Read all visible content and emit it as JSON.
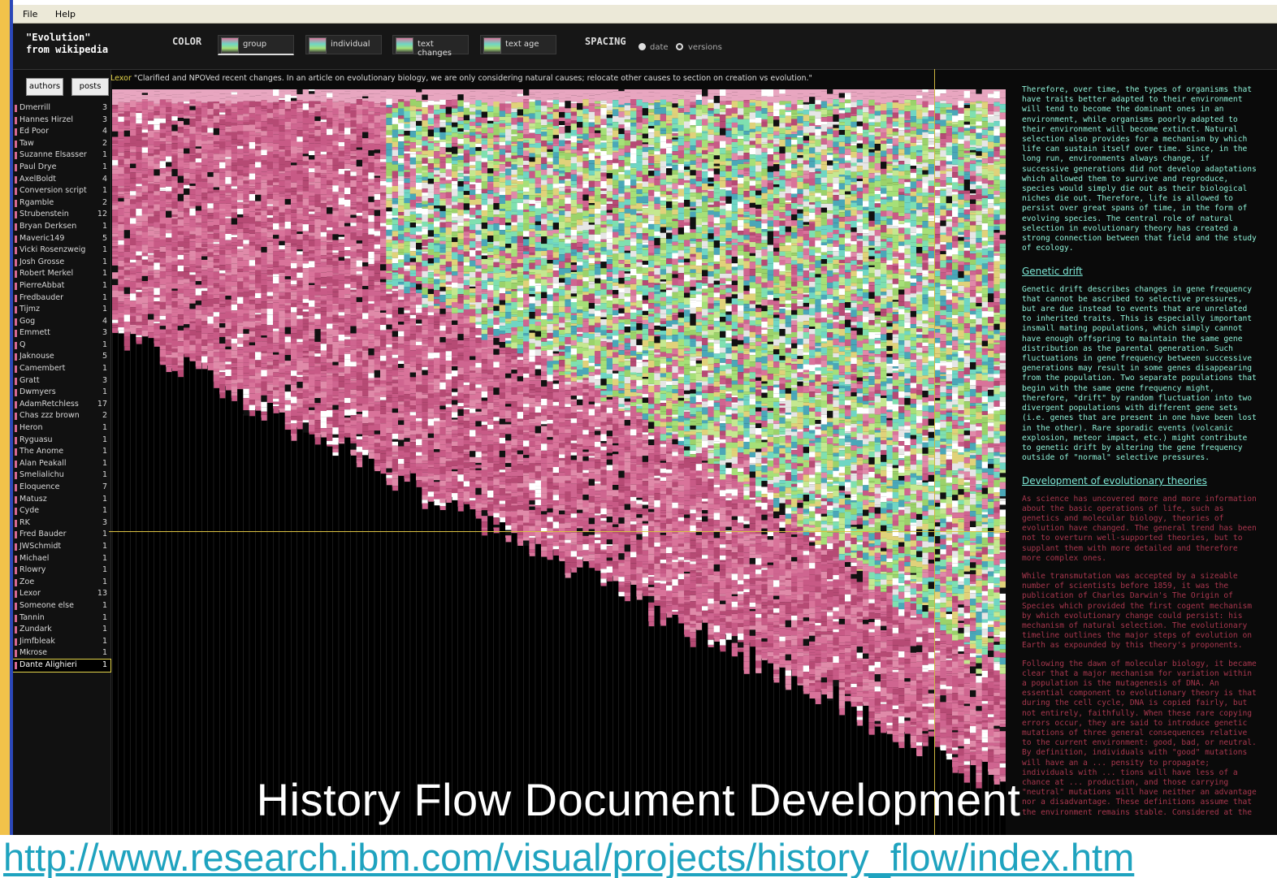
{
  "menu": {
    "items": [
      "File",
      "Help"
    ]
  },
  "header": {
    "doc_title": "\"Evolution\"\nfrom wikipedia",
    "color_label": "COLOR",
    "color_options": [
      "group",
      "individual",
      "text changes",
      "text age"
    ],
    "spacing_label": "SPACING",
    "spacing_options": [
      "date",
      "versions"
    ],
    "spacing_selected": "versions"
  },
  "sidebar": {
    "tabs": [
      "authors",
      "posts"
    ],
    "authors": [
      {
        "name": "Dmerrill",
        "count": "3"
      },
      {
        "name": "Hannes Hirzel",
        "count": "3"
      },
      {
        "name": "Ed Poor",
        "count": "4"
      },
      {
        "name": "Taw",
        "count": "2"
      },
      {
        "name": "Suzanne Elsasser",
        "count": "1"
      },
      {
        "name": "Paul Drye",
        "count": "1"
      },
      {
        "name": "AxelBoldt",
        "count": "4"
      },
      {
        "name": "Conversion script",
        "count": "1"
      },
      {
        "name": "Rgamble",
        "count": "2"
      },
      {
        "name": "Strubenstein",
        "count": "12"
      },
      {
        "name": "Bryan Derksen",
        "count": "1"
      },
      {
        "name": "Maveric149",
        "count": "5"
      },
      {
        "name": "Vicki Rosenzweig",
        "count": "1"
      },
      {
        "name": "Josh Grosse",
        "count": "1"
      },
      {
        "name": "Robert Merkel",
        "count": "1"
      },
      {
        "name": "PierreAbbat",
        "count": "1"
      },
      {
        "name": "Fredbauder",
        "count": "1"
      },
      {
        "name": "Tijmz",
        "count": "1"
      },
      {
        "name": "Gog",
        "count": "4"
      },
      {
        "name": "Emmett",
        "count": "3"
      },
      {
        "name": "Q",
        "count": "1"
      },
      {
        "name": "Jaknouse",
        "count": "5"
      },
      {
        "name": "Camembert",
        "count": "1"
      },
      {
        "name": "Gratt",
        "count": "3"
      },
      {
        "name": "Dwmyers",
        "count": "1"
      },
      {
        "name": "AdamRetchless",
        "count": "17"
      },
      {
        "name": "Chas zzz brown",
        "count": "2"
      },
      {
        "name": "Heron",
        "count": "1"
      },
      {
        "name": "Ryguasu",
        "count": "1"
      },
      {
        "name": "The Anome",
        "count": "1"
      },
      {
        "name": "Alan Peakall",
        "count": "1"
      },
      {
        "name": "Smelialichu",
        "count": "1"
      },
      {
        "name": "Eloquence",
        "count": "7"
      },
      {
        "name": "Matusz",
        "count": "1"
      },
      {
        "name": "Cyde",
        "count": "1"
      },
      {
        "name": "RK",
        "count": "3"
      },
      {
        "name": "Fred Bauder",
        "count": "1"
      },
      {
        "name": "JWSchmidt",
        "count": "1"
      },
      {
        "name": "Michael",
        "count": "1"
      },
      {
        "name": "Rlowry",
        "count": "1"
      },
      {
        "name": "Zoe",
        "count": "1"
      },
      {
        "name": "Lexor",
        "count": "13"
      },
      {
        "name": "Someone else",
        "count": "1"
      },
      {
        "name": "Tannin",
        "count": "1"
      },
      {
        "name": "Zundark",
        "count": "1"
      },
      {
        "name": "Jimfbleak",
        "count": "1"
      },
      {
        "name": "Mkrose",
        "count": "1"
      },
      {
        "name": "Dante Alighieri",
        "count": "1"
      }
    ],
    "selected_author": "Dante Alighieri"
  },
  "comment": {
    "author": "Lexor",
    "text": "\"Clarified and NPOVed recent changes.  In an article on evolutionary biology, we are only considering natural causes; relocate other causes to section on creation vs evolution.\""
  },
  "article": {
    "p1": "Therefore, over time, the types of organisms that have traits better adapted to their environment will tend to become the dominant ones in an environment, while organisms poorly adapted to their environment will become extinct. Natural selection also provides for a mechanism by which life can sustain itself over time. Since, in the long run, environments always change, if successive generations did not develop adaptations which allowed them to survive and reproduce, species would simply die out as their biological niches die out.  Therefore, life is allowed to persist over great spans of time, in the form of evolving species.  The central role of natural selection in evolutionary theory has created a strong connection between that field and the study of ecology.",
    "h1": "Genetic drift",
    "p2": "Genetic drift describes changes in gene frequency that cannot be ascribed to selective pressures, but are due instead to events that are unrelated to inherited traits. This is especially important insmall mating populations, which simply cannot have enough offspring to maintain the same gene distribution as the parental generation. Such fluctuations in gene frequency between successive generations may result in some genes disappearing from the population. Two separate populations that begin with the same gene frequency might, therefore, \"drift\" by random fluctuation into two divergent populations with different gene sets (i.e. genes that are present in one have been lost in the other). Rare sporadic events (volcanic explosion, meteor impact, etc.) might contribute to genetic drift by altering the gene frequency outside of \"normal\" selective pressures.",
    "h2": "Development of evolutionary theories",
    "p3": "As science has uncovered more and more information about the basic operations of life, such as genetics and molecular biology, theories of evolution have changed. The general trend has been not to overturn well-supported theories, but to supplant them with more detailed and therefore more complex ones.",
    "p4": "While transmutation was accepted by a sizeable number of scientists before 1859, it was the publication of Charles Darwin's The Origin of Species which provided the first cogent mechanism by which evolutionary change could persist: his mechanism of natural selection. The evolutionary timeline outlines the major steps of evolution on Earth as expounded by this theory's proponents.",
    "p5": "Following the dawn of molecular biology, it became clear that a major mechanism for variation within a population is the mutagenesis of DNA. An essential component to evolutionary theory is that during the cell cycle, DNA is copied fairly, but not entirely, faithfully. When these rare copying errors occur, they are said to introduce genetic mutations of three general consequences relative to the current environment:  good, bad, or neutral.  By definition, individuals with \"good\" mutations will have an a ... pensity to propagate; individuals with ... tions will have less of a chance at ... production, and those carrying \"neutral\" mutations will have neither an advantage nor a disadvantage. These definitions assume that the environment remains stable. Considered at the"
  },
  "slide": {
    "title": "History Flow Document  Development",
    "link": "http://www.research.ibm.com/visual/projects/history_flow/index.htm"
  },
  "colors": {
    "accent_yellow": "#f2c24a",
    "accent_blue": "#2b47b8",
    "group_pink": "#d66a93",
    "group_teal": "#6fd6c4",
    "group_green": "#a6e078",
    "link_cyan": "#1fa3bf"
  },
  "chart_data": {
    "type": "area",
    "title": "",
    "xlabel": "",
    "ylabel": "",
    "legend": "none",
    "grid": false
  }
}
